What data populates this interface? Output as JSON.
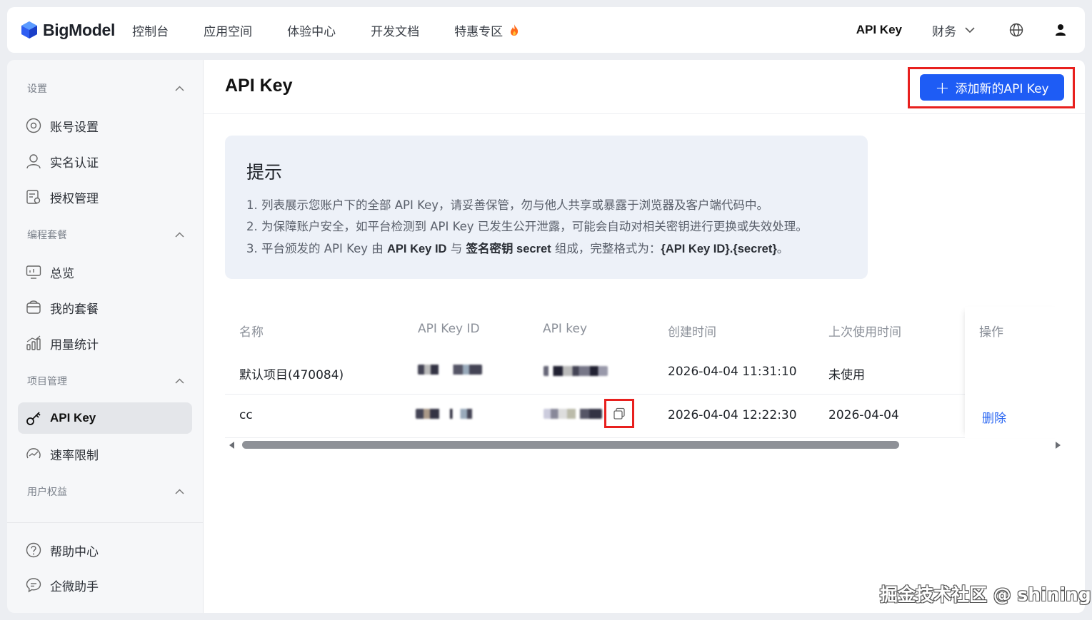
{
  "nav": {
    "brand": "BigModel",
    "links": [
      "控制台",
      "应用空间",
      "体验中心",
      "开发文档",
      "特惠专区"
    ],
    "api_key": "API Key",
    "finance": "财务",
    "accent": "#1e5cf5",
    "fire_icon": "fire-icon"
  },
  "sidebar": {
    "sections": [
      {
        "title": "设置",
        "items": [
          "账号设置",
          "实名认证",
          "授权管理"
        ]
      },
      {
        "title": "编程套餐",
        "items": [
          "总览",
          "我的套餐",
          "用量统计"
        ]
      },
      {
        "title": "项目管理",
        "items": [
          "API Key",
          "速率限制"
        ]
      },
      {
        "title": "用户权益",
        "items": []
      }
    ],
    "footer": [
      "帮助中心",
      "企微助手"
    ],
    "active": "API Key"
  },
  "main": {
    "title": "API Key",
    "add_button": "添加新的API Key",
    "tip": {
      "title": "提示",
      "line1": "1. 列表展示您账户下的全部 API Key，请妥善保管，勿与他人共享或暴露于浏览器及客户端代码中。",
      "line2": "2. 为保障账户安全，如平台检测到 API Key 已发生公开泄露，可能会自动对相关密钥进行更换或失效处理。",
      "line3_a": "3. 平台颁发的 API Key 由 ",
      "line3_b": "API Key ID",
      "line3_c": " 与 ",
      "line3_d": "签名密钥",
      "line3_e": " secret",
      "line3_f": " 组成，完整格式为：",
      "line3_g": "{API Key ID}",
      "line3_h": ".{secret}",
      "line3_i": "。"
    },
    "table": {
      "headers": [
        "名称",
        "API Key ID",
        "API key",
        "创建时间",
        "上次使用时间",
        "操作"
      ],
      "rows": [
        {
          "name": "默认项目(470084)",
          "created": "2026-04-04 11:31:10",
          "last_used": "未使用",
          "action": ""
        },
        {
          "name": "cc",
          "created": "2026-04-04 12:22:30",
          "last_used": "2026-04-04",
          "action": "删除"
        }
      ]
    }
  },
  "watermark": "掘金技术社区 @ shining"
}
